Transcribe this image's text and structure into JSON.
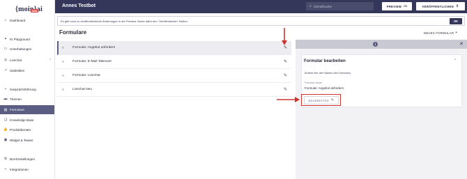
{
  "sidebar": {
    "logo_text": "{moin}ai",
    "logo_badge": "beta",
    "items": [
      {
        "label": "Dashboard",
        "icon": "home-icon"
      },
      {
        "label": "KI Playground",
        "icon": "sparkle-icon"
      },
      {
        "label": "Unterhaltungen",
        "icon": "chat-icon"
      },
      {
        "label": "Livechat",
        "icon": "headset-icon",
        "badge": "0"
      },
      {
        "label": "Statistiken",
        "icon": "chart-icon"
      },
      {
        "label": "Gesprächsführung",
        "icon": "flow-icon"
      },
      {
        "label": "Themen",
        "icon": "folder-icon"
      },
      {
        "label": "Formulare",
        "icon": "form-icon"
      },
      {
        "label": "Knowledge Base",
        "icon": "book-icon"
      },
      {
        "label": "Produktberater",
        "icon": "thumbs-up-icon"
      },
      {
        "label": "Widget & Teaser",
        "icon": "widget-icon"
      },
      {
        "label": "Bot-Einstellungen",
        "icon": "gear-icon"
      },
      {
        "label": "Integrationen",
        "icon": "plug-icon"
      }
    ],
    "active_index": 7
  },
  "topbar": {
    "title": "Annes Testbot",
    "search_placeholder": "Schnellsuche",
    "preview_label": "PREVIEW",
    "publish_label": "VERÖFFENTLICHEN"
  },
  "notice": {
    "text": "Es gibt noch zu veröffentlichende Änderungen in der Preview. Nutze dafür den \"Veröffentlichen\" Button.",
    "ok_label": "OK"
  },
  "main": {
    "title": "Formulare",
    "new_form_label": "NEUES FORMULAR",
    "forms": [
      {
        "label": "Formular: Angebot anfordern",
        "selected": true
      },
      {
        "label": "Formular: E-Mail Takeover",
        "selected": false
      },
      {
        "label": "Formular: Livechat",
        "selected": false
      },
      {
        "label": "Livechat Neu",
        "selected": false
      }
    ]
  },
  "panel": {
    "card_title": "Formular bearbeiten",
    "hint": "Ändere hier den Namen des Formulars.",
    "field_label": "Formular Name",
    "field_value": "Formular: Angebot anfordern",
    "edit_label": "BEARBEITEN"
  },
  "colors": {
    "topbar": "#34365a",
    "active_nav": "#5b5d83",
    "annotation": "#d0332d"
  }
}
